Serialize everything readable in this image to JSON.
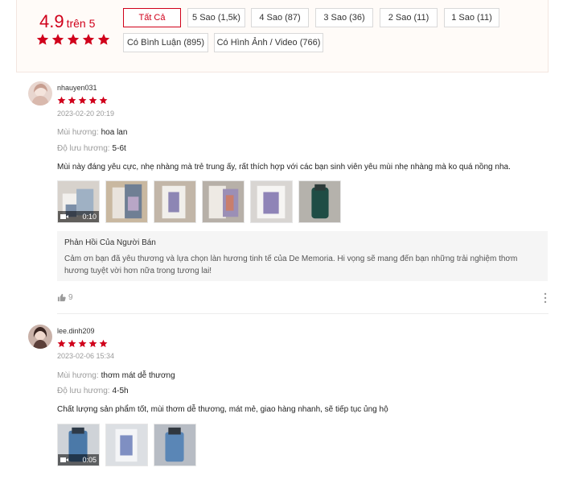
{
  "summary": {
    "score": "4.9",
    "out_of": "trên 5",
    "stars": 5,
    "filters": [
      {
        "label": "Tất Cả",
        "active": true
      },
      {
        "label": "5 Sao (1,5k)"
      },
      {
        "label": "4 Sao (87)"
      },
      {
        "label": "3 Sao (36)"
      },
      {
        "label": "2 Sao (11)"
      },
      {
        "label": "1 Sao (11)"
      },
      {
        "label": "Có Bình Luận (895)"
      },
      {
        "label": "Có Hình Ảnh / Video (766)"
      }
    ]
  },
  "colors": {
    "accent": "#d0011b",
    "muted": "#9a9a9a"
  },
  "reviews": [
    {
      "username": "nhauyen031",
      "stars": 5,
      "datetime": "2023-02-20 20:19",
      "scent_label": "Mùi hương:",
      "scent_value": "hoa lan",
      "longevity_label": "Độ lưu hương:",
      "longevity_value": "5-6t",
      "content": "Mùi này đáng yêu cực, nhẹ nhàng mà trẻ trung ấy, rất thích hợp với các bạn sinh viên yêu mùi nhẹ nhàng mà ko quá nồng nha.",
      "video_duration": "0:10",
      "reply_title": "Phản Hồi Của Người Bán",
      "reply_text": "Cảm ơn bạn đã yêu thương và lựa chọn làn hương tinh tế của De Memoria. Hi vọng sẽ mang đến bạn những trải nghiệm thơm hương tuyệt vời hơn nữa trong tương lai!",
      "likes": "9"
    },
    {
      "username": "lee.dinh209",
      "stars": 5,
      "datetime": "2023-02-06 15:34",
      "scent_label": "Mùi hương:",
      "scent_value": "thơm mát dễ thương",
      "longevity_label": "Độ lưu hương:",
      "longevity_value": "4-5h",
      "content": "Chất lượng sản phẩm tốt, mùi thơm dễ thương, mát mẻ, giao hàng nhanh, sẽ tiếp tục ủng hộ",
      "video_duration": "0:05"
    }
  ]
}
